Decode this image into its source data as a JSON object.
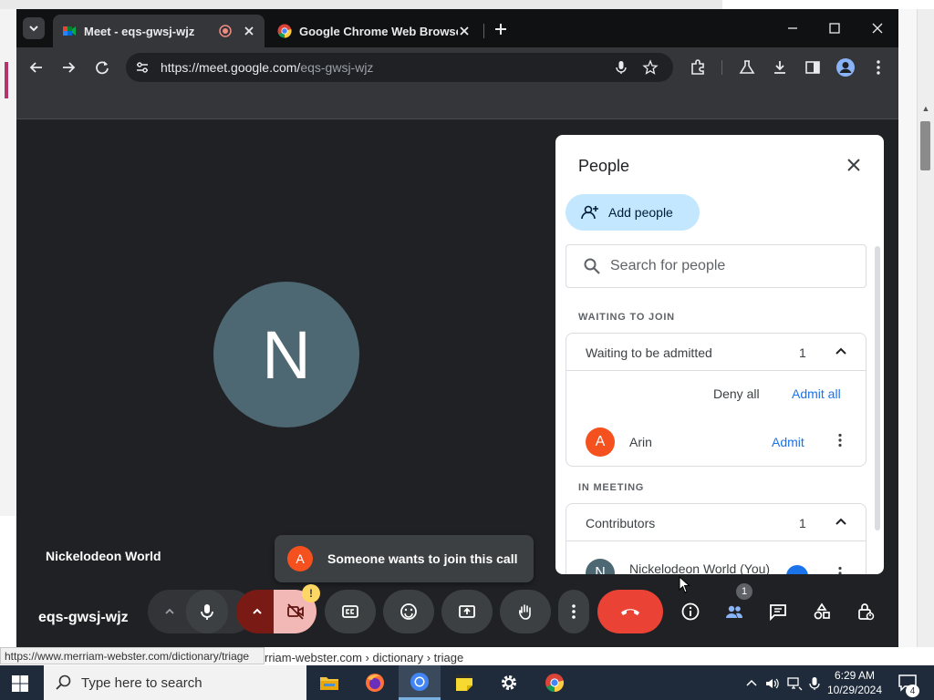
{
  "browser": {
    "tabs": [
      {
        "title": "Meet - eqs-gwsj-wjz",
        "active": true,
        "recording_icon": "record-icon",
        "favicon": "google-meet-icon"
      },
      {
        "title": "Google Chrome Web Browser",
        "active": false,
        "favicon": "chrome-icon"
      }
    ],
    "address": {
      "host": "https://meet.google.com/",
      "path": "eqs-gwsj-wjz"
    }
  },
  "meet": {
    "self_tile": {
      "initial": "N",
      "name": "Nickelodeon World"
    },
    "meeting_code": "eqs-gwsj-wjz",
    "toast": {
      "avatar": "A",
      "text": "Someone wants to join this call"
    },
    "camera_warning": "!",
    "people_count": "1",
    "colors": {
      "end_call": "#ea4335",
      "camera_off": "#f2b8b5",
      "accent": "#1a73e8"
    }
  },
  "panel": {
    "title": "People",
    "add_people": "Add people",
    "search_placeholder": "Search for people",
    "waiting_section": "WAITING TO JOIN",
    "waiting_group": {
      "label": "Waiting to be admitted",
      "count": "1"
    },
    "deny_all": "Deny all",
    "admit_all": "Admit all",
    "waiting_person": {
      "initial": "A",
      "name": "Arin",
      "action": "Admit"
    },
    "in_meeting_section": "IN MEETING",
    "contributors_group": {
      "label": "Contributors",
      "count": "1"
    },
    "me": {
      "initial": "N",
      "name": "Nickelodeon World (You)"
    }
  },
  "status_bar": {
    "url": "https://www.merriam-webster.com/dictionary/triage",
    "behind": "rriam-webster.com › dictionary › triage"
  },
  "taskbar": {
    "search_placeholder": "Type here to search",
    "apps": [
      "file-explorer-icon",
      "firefox-icon",
      "chrome-icon",
      "sticky-notes-icon",
      "settings-icon",
      "chrome-icon"
    ],
    "time": "6:29 AM",
    "date": "10/29/2024",
    "notifications": "4"
  }
}
